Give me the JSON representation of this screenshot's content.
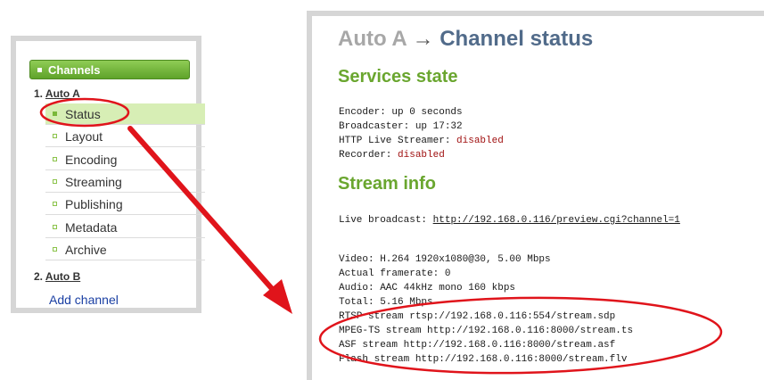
{
  "sidebar": {
    "header": "Channels",
    "channel_a": {
      "number": "1.",
      "name": "Auto A"
    },
    "items": [
      {
        "label": "Status",
        "active": true
      },
      {
        "label": "Layout"
      },
      {
        "label": "Encoding"
      },
      {
        "label": "Streaming"
      },
      {
        "label": "Publishing"
      },
      {
        "label": "Metadata"
      },
      {
        "label": "Archive"
      }
    ],
    "channel_b": {
      "number": "2.",
      "name": "Auto B"
    },
    "add_channel": "Add channel"
  },
  "main": {
    "breadcrumb": "Auto A",
    "arrow": "→",
    "title": "Channel status",
    "services": {
      "title": "Services state",
      "encoder_label": "Encoder:",
      "encoder_value": "up 0 seconds",
      "broadcaster_label": "Broadcaster:",
      "broadcaster_value": "up 17:32",
      "hls_label": "HTTP Live Streamer:",
      "hls_value": "disabled",
      "recorder_label": "Recorder:",
      "recorder_value": "disabled"
    },
    "stream": {
      "title": "Stream info",
      "live_label": "Live broadcast:",
      "live_url": "http://192.168.0.116/preview.cgi?channel=1",
      "video": "Video: H.264 1920x1080@30, 5.00 Mbps",
      "framerate": "Actual framerate: 0",
      "audio": "Audio: AAC 44kHz mono 160 kbps",
      "total": "Total: 5.16 Mbps",
      "rtsp": "RTSP stream rtsp://192.168.0.116:554/stream.sdp",
      "mpegts": "MPEG-TS stream http://192.168.0.116:8000/stream.ts",
      "asf": "ASF stream http://192.168.0.116:8000/stream.asf",
      "flash": "Flash stream http://192.168.0.116:8000/stream.flv"
    }
  },
  "colors": {
    "green_accent": "#6aa62f",
    "title_blue": "#516b8a",
    "annotation_red": "#e0141b",
    "disabled_red": "#a01010"
  }
}
